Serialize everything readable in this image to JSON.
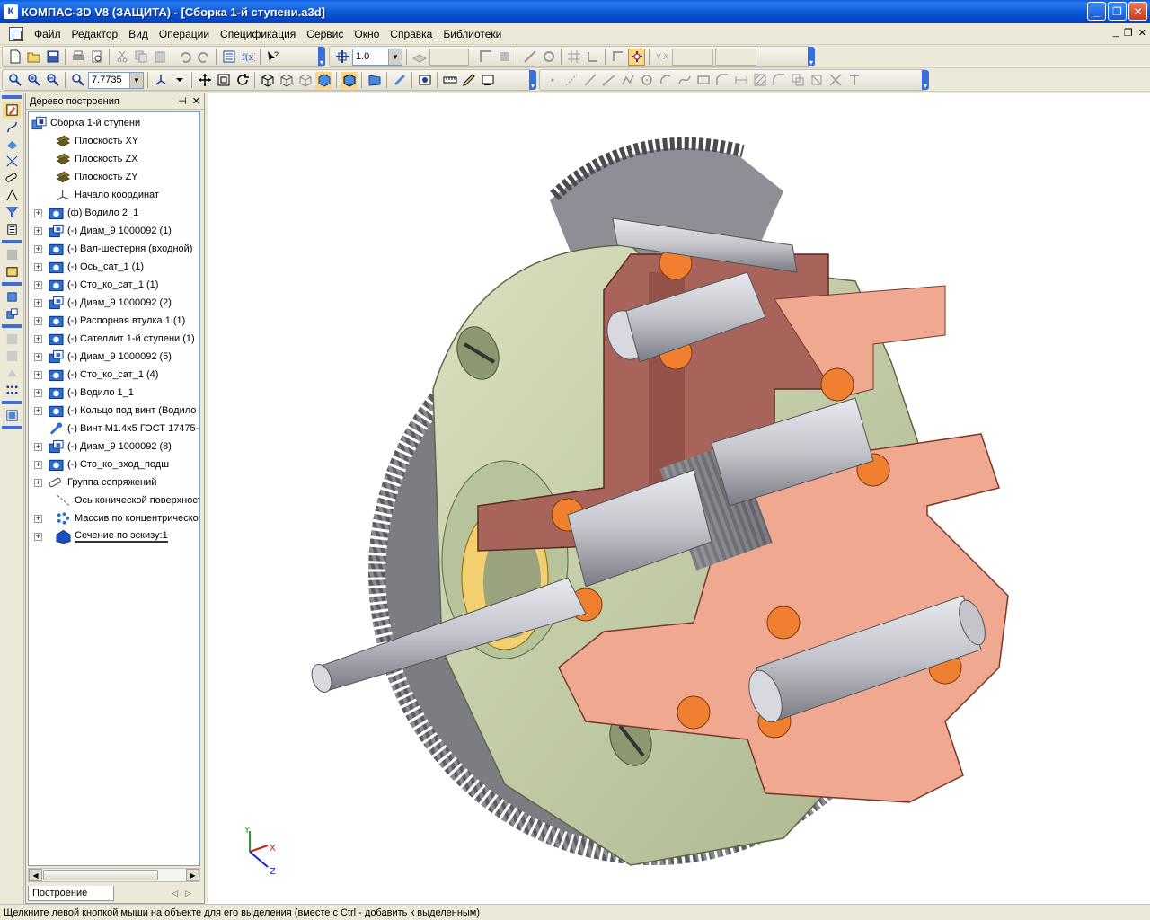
{
  "window": {
    "title": "КОМПАС-3D V8 (ЗАЩИТА) - [Сборка 1-й ступени.a3d]",
    "app_icon": "К"
  },
  "menu": {
    "items": [
      "Файл",
      "Редактор",
      "Вид",
      "Операции",
      "Спецификация",
      "Сервис",
      "Окно",
      "Справка",
      "Библиотеки"
    ]
  },
  "toolbar": {
    "step_value": "1.0",
    "zoom_value": "7.7735"
  },
  "tree": {
    "title": "Дерево построения",
    "root": "Сборка 1-й ступени",
    "items": [
      {
        "label": "Плоскость XY",
        "icon": "plane-icon",
        "expandable": false,
        "indent": 1
      },
      {
        "label": "Плоскость ZX",
        "icon": "plane-icon",
        "expandable": false,
        "indent": 1
      },
      {
        "label": "Плоскость ZY",
        "icon": "plane-icon",
        "expandable": false,
        "indent": 1
      },
      {
        "label": "Начало координат",
        "icon": "origin-icon",
        "expandable": false,
        "indent": 1
      },
      {
        "label": "(ф) Водило 2_1",
        "icon": "part-icon",
        "expandable": true,
        "indent": 0
      },
      {
        "label": "(-) Диам_9 1000092 (1)",
        "icon": "subassembly-icon",
        "expandable": true,
        "indent": 0
      },
      {
        "label": "(-) Вал-шестерня (входной)",
        "icon": "part-icon",
        "expandable": true,
        "indent": 0
      },
      {
        "label": "(-) Ось_сат_1 (1)",
        "icon": "part-icon",
        "expandable": true,
        "indent": 0
      },
      {
        "label": "(-) Сто_ко_сат_1 (1)",
        "icon": "part-icon",
        "expandable": true,
        "indent": 0
      },
      {
        "label": "(-) Диам_9 1000092 (2)",
        "icon": "subassembly-icon",
        "expandable": true,
        "indent": 0
      },
      {
        "label": "(-) Распорная втулка 1 (1)",
        "icon": "part-icon",
        "expandable": true,
        "indent": 0
      },
      {
        "label": "(-) Сателлит 1-й ступени (1)",
        "icon": "part-icon",
        "expandable": true,
        "indent": 0
      },
      {
        "label": "(-) Диам_9 1000092 (5)",
        "icon": "subassembly-icon",
        "expandable": true,
        "indent": 0
      },
      {
        "label": "(-) Сто_ко_сат_1 (4)",
        "icon": "part-icon",
        "expandable": true,
        "indent": 0
      },
      {
        "label": "(-) Водило 1_1",
        "icon": "part-icon",
        "expandable": true,
        "indent": 0
      },
      {
        "label": "(-) Кольцо под винт (Водило",
        "icon": "part-icon",
        "expandable": true,
        "indent": 0
      },
      {
        "label": "(-) Винт М1.4x5 ГОСТ 17475-",
        "icon": "standard-part-icon",
        "expandable": false,
        "indent": 0
      },
      {
        "label": "(-) Диам_9 1000092 (8)",
        "icon": "subassembly-icon",
        "expandable": true,
        "indent": 0
      },
      {
        "label": "(-) Сто_ко_вход_подш",
        "icon": "part-icon",
        "expandable": true,
        "indent": 0
      },
      {
        "label": "Группа сопряжений",
        "icon": "mates-icon",
        "expandable": true,
        "indent": 0
      },
      {
        "label": "Ось конической поверхност",
        "icon": "axis-icon",
        "expandable": false,
        "indent": 1
      },
      {
        "label": "Массив по концентрической",
        "icon": "pattern-icon",
        "expandable": true,
        "indent": 1
      },
      {
        "label": "Сечение по эскизу:1",
        "icon": "section-icon",
        "expandable": true,
        "indent": 1,
        "selected": true
      }
    ],
    "tab": "Построение"
  },
  "viewport": {
    "axes": {
      "x": "X",
      "y": "Y",
      "z": "Z"
    },
    "colors": {
      "housing": "#c9d3ad",
      "carrier": "#a8645a",
      "section_pink": "#f0a890",
      "shaft": "#c8c8d0",
      "gear": "#8a8a8a",
      "bearing_orange": "#f08030"
    }
  },
  "status": {
    "text": "Щелкните левой кнопкой мыши на объекте для его выделения (вместе с Ctrl - добавить к выделенным)"
  }
}
